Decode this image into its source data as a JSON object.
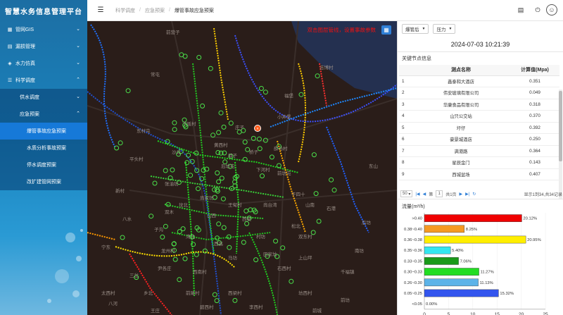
{
  "app": {
    "title": "智慧水务信息管理平台"
  },
  "sidebar": {
    "items": [
      {
        "label": "管网GIS",
        "icon": "map-icon"
      },
      {
        "label": "漏损管理",
        "icon": "leak-icon"
      },
      {
        "label": "水力仿真",
        "icon": "simulation-icon"
      },
      {
        "label": "科学调度",
        "icon": "dispatch-icon"
      }
    ],
    "sub": [
      {
        "label": "供水调度"
      },
      {
        "label": "应急预案"
      }
    ],
    "sub2": [
      {
        "label": "爆管事故应急预案"
      },
      {
        "label": "水质分析事故预案"
      },
      {
        "label": "停水调度预案"
      },
      {
        "label": "改扩建管网预案"
      }
    ]
  },
  "breadcrumb": {
    "items": [
      "科学调度",
      "应急预案",
      "爆管事故应急预案"
    ]
  },
  "topbar": {
    "icons": [
      "notice-icon",
      "power-icon",
      "user-icon"
    ]
  },
  "map": {
    "hint": "双击图层管线，设置事故参数",
    "button_icon": "layers-icon",
    "places": [
      "前营子",
      "吉博村",
      "常屯",
      "福堡",
      "小井堡",
      "下坂村",
      "庄子",
      "东村屯",
      "黄西村",
      "邱子",
      "桥子",
      "薛马村",
      "沙北",
      "平头村",
      "后坊屯",
      "下河村",
      "前坊屯",
      "张油坊",
      "新村",
      "干四十",
      "尚家坊",
      "王甸村",
      "尚台湾",
      "坟北",
      "双木",
      "山南",
      "石港",
      "山西",
      "西梁",
      "八水",
      "松北",
      "子沟",
      "湾北",
      "西高",
      "村坊",
      "双东村",
      "宁东",
      "龙州村",
      "田家坊",
      "马坊",
      "尹各庄",
      "西南村",
      "三岔",
      "石西村",
      "上山坪",
      "太西村",
      "乡北",
      "前尾村",
      "西梁村",
      "坊西村",
      "八河",
      "王庄",
      "碧西村",
      "李西村",
      "前城",
      "千福镇",
      "前坊",
      "南坊",
      "后坊",
      "东山"
    ],
    "marker_icon": "burst-marker-icon"
  },
  "panel": {
    "sel1": "爆管后",
    "sel2": "压力",
    "datetime": "2024-07-03 10:21:39",
    "section": "关键节点信息",
    "columns": [
      "测点名称",
      "计算值(Mpa)"
    ],
    "rows": [
      {
        "idx": "1",
        "name": "鑫泰和大酒店",
        "val": "0.351"
      },
      {
        "idx": "2",
        "name": "伟安玻璃有限公司",
        "val": "0.049"
      },
      {
        "idx": "3",
        "name": "华康食品有限公司",
        "val": "0.318"
      },
      {
        "idx": "4",
        "name": "山只公交站",
        "val": "0.370"
      },
      {
        "idx": "5",
        "name": "圩仔",
        "val": "0.392"
      },
      {
        "idx": "6",
        "name": "豪景城酒店",
        "val": "0.250"
      },
      {
        "idx": "7",
        "name": "满港路",
        "val": "0.364"
      },
      {
        "idx": "8",
        "name": "星辰金门",
        "val": "0.143"
      },
      {
        "idx": "9",
        "name": "西城盆场",
        "val": "0.407"
      }
    ],
    "pager": {
      "size": "50",
      "page": "1",
      "total": "共1页",
      "info": "显示1到34,共34记录"
    }
  },
  "chart_data": {
    "type": "bar",
    "title": "流量(m³/h)",
    "orientation": "horizontal",
    "categories": [
      ">0.40",
      "0.38~0.40",
      "0.36~0.38",
      "0.35~0.36",
      "0.33~0.35",
      "0.30~0.33",
      "0.26~0.30",
      "0.05~0.25",
      "<0.05"
    ],
    "values": [
      20.12,
      8.25,
      20.95,
      5.4,
      7.06,
      11.27,
      11.13,
      15.32,
      0.0
    ],
    "labels": [
      "20.12%",
      "8.25%",
      "20.95%",
      "5.40%",
      "7.06%",
      "11.27%",
      "11.13%",
      "15.32%",
      "0.00%"
    ],
    "colors": [
      "#f00000",
      "#f59a23",
      "#ffee00",
      "#33e6f0",
      "#1a9a1a",
      "#22dd22",
      "#5cb3e8",
      "#3355ee",
      "#ffffff"
    ],
    "xlim": [
      0,
      25
    ],
    "xticks": [
      "0",
      "5",
      "10",
      "15",
      "20",
      "25"
    ]
  }
}
